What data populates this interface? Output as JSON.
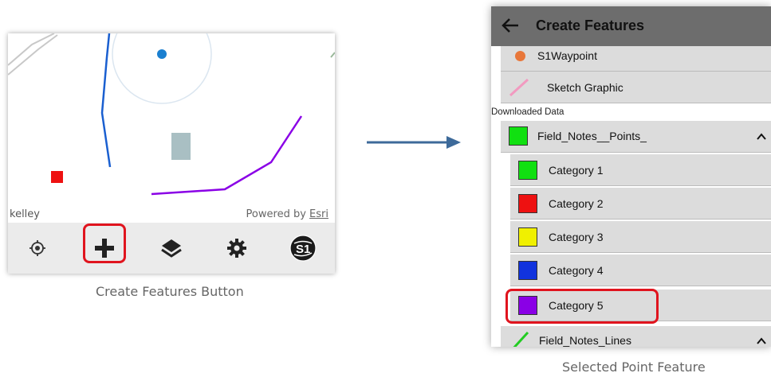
{
  "map": {
    "attribution_left": "kelley",
    "attribution_powered": "Powered by",
    "attribution_link": "Esri",
    "toolbar": [
      "locate-icon",
      "add-icon",
      "layers-icon",
      "settings-icon",
      "s1-logo-icon"
    ]
  },
  "captions": {
    "left": "Create Features Button",
    "right": "Selected Point Feature"
  },
  "create_features": {
    "title": "Create Features",
    "items_top": [
      {
        "label": "S1Waypoint",
        "icon": "orange-dot-icon",
        "color": "#e8773a"
      },
      {
        "label": "Sketch Graphic",
        "icon": "pink-line-icon",
        "color": "#f29ac0"
      }
    ],
    "section_label": "Downloaded Data",
    "points_layer": {
      "label": "Field_Notes__Points_",
      "color": "#11e011"
    },
    "categories": [
      {
        "label": "Category 1",
        "color": "#11e011"
      },
      {
        "label": "Category 2",
        "color": "#ee1111"
      },
      {
        "label": "Category 3",
        "color": "#f0f000"
      },
      {
        "label": "Category 4",
        "color": "#1133dd"
      },
      {
        "label": "Category 5",
        "color": "#8a00e6"
      }
    ],
    "lines_layer": {
      "label": "Field_Notes_Lines",
      "color": "#22cc22"
    }
  },
  "colors": {
    "highlight": "#e0141e",
    "header_bg": "#6d6d6d",
    "row_bg": "#dcdcdc",
    "arrow": "#3d6a9a"
  }
}
